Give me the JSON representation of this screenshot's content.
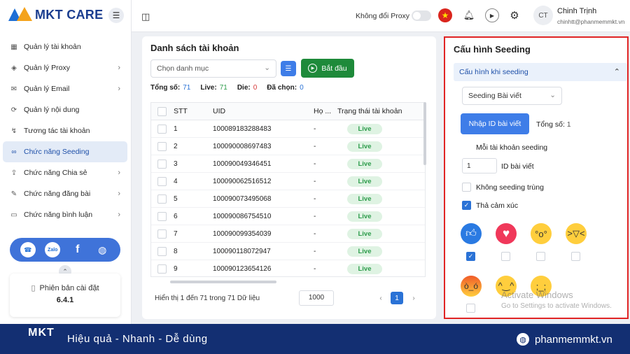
{
  "app": {
    "logo_text": "MKT CARE",
    "menu_icon": "hamburger-icon"
  },
  "sidebar": {
    "items": [
      {
        "label": "Quản lý tài khoản",
        "icon": "grid-icon",
        "has_chevron": false
      },
      {
        "label": "Quản lý Proxy",
        "icon": "layers-icon",
        "has_chevron": true
      },
      {
        "label": "Quản lý Email",
        "icon": "mail-icon",
        "has_chevron": true
      },
      {
        "label": "Quản lý nội dung",
        "icon": "content-icon",
        "has_chevron": false
      },
      {
        "label": "Tương tác tài khoản",
        "icon": "interaction-icon",
        "has_chevron": false
      },
      {
        "label": "Chức năng Seeding",
        "icon": "link-icon",
        "has_chevron": false,
        "active": true
      },
      {
        "label": "Chức năng Chia sẻ",
        "icon": "share-icon",
        "has_chevron": true
      },
      {
        "label": "Chức năng đăng bài",
        "icon": "edit-icon",
        "has_chevron": true
      },
      {
        "label": "Chức năng bình luận",
        "icon": "comment-icon",
        "has_chevron": true
      }
    ],
    "social": {
      "zalo": "Zalo",
      "facebook": "f"
    },
    "version_label": "Phiên bản cài đặt",
    "version_number": "6.4.1"
  },
  "topbar": {
    "proxy_label": "Không đổi Proxy",
    "proxy_enabled": false,
    "user_initials": "CT",
    "user_name": "Chinh Trịnh",
    "user_email": "chinhtt@phanmemmkt.vn"
  },
  "account_list": {
    "title": "Danh sách tài khoản",
    "category_placeholder": "Chọn danh mục",
    "start_button": "Bắt đầu",
    "stats": {
      "total_label": "Tổng số:",
      "total": "71",
      "live_label": "Live:",
      "live": "71",
      "die_label": "Die:",
      "die": "0",
      "selected_label": "Đã chọn:",
      "selected": "0"
    },
    "columns": [
      "STT",
      "UID",
      "Họ ...",
      "Trạng thái tài khoản"
    ],
    "rows": [
      {
        "stt": "1",
        "uid": "100089183288483",
        "ho": "-",
        "status": "Live"
      },
      {
        "stt": "2",
        "uid": "100090008697483",
        "ho": "-",
        "status": "Live"
      },
      {
        "stt": "3",
        "uid": "100090049346451",
        "ho": "-",
        "status": "Live"
      },
      {
        "stt": "4",
        "uid": "100090062516512",
        "ho": "-",
        "status": "Live"
      },
      {
        "stt": "5",
        "uid": "100090073495068",
        "ho": "-",
        "status": "Live"
      },
      {
        "stt": "6",
        "uid": "100090086754510",
        "ho": "-",
        "status": "Live"
      },
      {
        "stt": "7",
        "uid": "100090099354039",
        "ho": "-",
        "status": "Live"
      },
      {
        "stt": "8",
        "uid": "100090118072947",
        "ho": "-",
        "status": "Live"
      },
      {
        "stt": "9",
        "uid": "100090123654126",
        "ho": "-",
        "status": "Live"
      }
    ],
    "footer_text": "Hiển thị 1 đến 71 trong 71 Dữ liệu",
    "page_size": "1000",
    "current_page": "1"
  },
  "seeding_config": {
    "title": "Cấu hình Seeding",
    "section_label": "Cấu hình khi seeding",
    "post_type": "Seeding Bài viết",
    "import_button": "Nhập ID bài viết",
    "total_label": "Tổng số:",
    "total": "1",
    "per_account_label": "Mỗi tài khoản seeding",
    "post_id_value": "1",
    "post_id_label": "ID bài viết",
    "no_duplicate_label": "Không seeding trùng",
    "no_duplicate_checked": false,
    "reaction_label": "Thả cảm xúc",
    "reaction_checked": true,
    "reactions": [
      {
        "name": "like",
        "icon": "thumbs-up-icon",
        "checked": true
      },
      {
        "name": "love",
        "icon": "heart-icon",
        "checked": false
      },
      {
        "name": "wow",
        "icon": "wow-face-icon",
        "checked": false
      },
      {
        "name": "haha",
        "icon": "haha-face-icon",
        "checked": false
      },
      {
        "name": "angry",
        "icon": "angry-face-icon",
        "checked": false
      },
      {
        "name": "care",
        "icon": "care-face-icon",
        "checked": false
      },
      {
        "name": "sad",
        "icon": "sad-face-icon",
        "checked": false
      }
    ]
  },
  "watermark": {
    "line1": "Activate Windows",
    "line2": "Go to Settings to activate Windows."
  },
  "banner": {
    "logo": "MKT",
    "slogan": "Hiệu quả - Nhanh - Dễ dùng",
    "website": "phanmemmkt.vn"
  }
}
